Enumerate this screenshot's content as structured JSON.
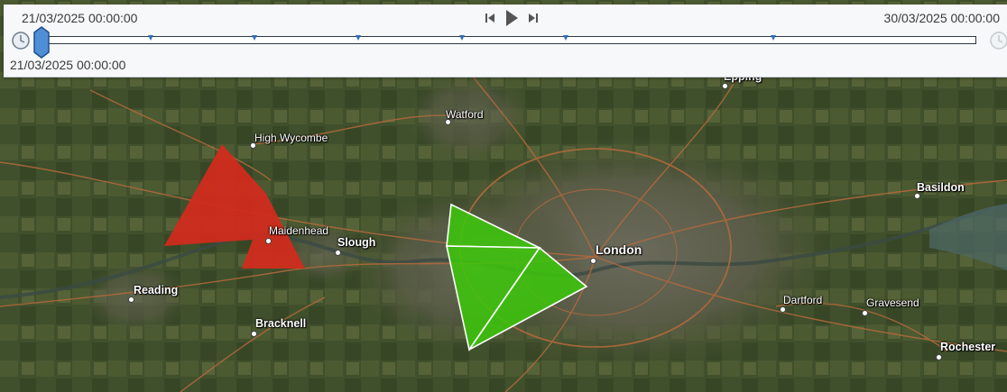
{
  "time_slider": {
    "start_label": "21/03/2025 00:00:00",
    "end_label": "30/03/2025 00:00:00",
    "current_label": "21/03/2025 00:00:00",
    "tick_count": 7,
    "position_fraction": 0.0
  },
  "map": {
    "basemap": "satellite imagery",
    "polygons": [
      {
        "name": "red-area-polygon",
        "fill": "#d42a1c"
      },
      {
        "name": "green-area-polygon",
        "fill": "#3cc80a",
        "stroke": "#ffffff"
      }
    ],
    "places": [
      {
        "key": "epping",
        "label": "Epping"
      },
      {
        "key": "watford",
        "label": "Watford"
      },
      {
        "key": "high_wycombe",
        "label": "High Wycombe"
      },
      {
        "key": "basildon",
        "label": "Basildon"
      },
      {
        "key": "maidenhead",
        "label": "Maidenhead"
      },
      {
        "key": "slough",
        "label": "Slough"
      },
      {
        "key": "london",
        "label": "London"
      },
      {
        "key": "reading",
        "label": "Reading"
      },
      {
        "key": "dartford",
        "label": "Dartford"
      },
      {
        "key": "gravesend",
        "label": "Gravesend"
      },
      {
        "key": "bracknell",
        "label": "Bracknell"
      },
      {
        "key": "rochester",
        "label": "Rochester"
      }
    ]
  }
}
